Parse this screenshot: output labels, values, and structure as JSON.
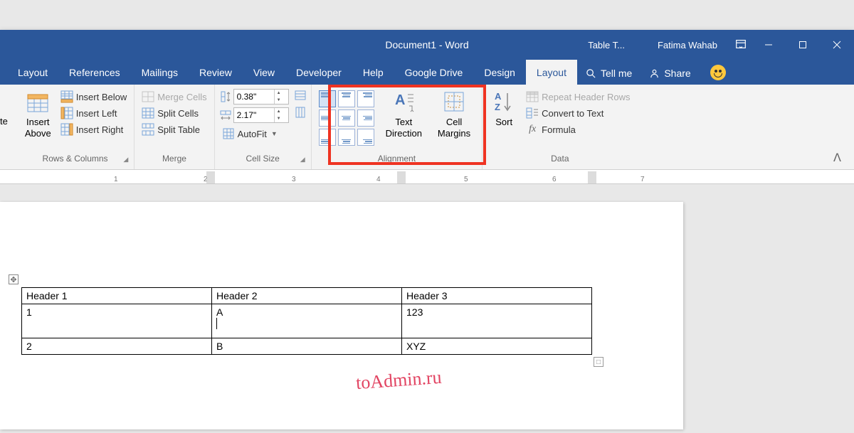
{
  "title": "Document1  -  Word",
  "context_tab_prefix": "Table T...",
  "user": "Fatima Wahab",
  "tabs": {
    "layout_page": "Layout",
    "references": "References",
    "mailings": "Mailings",
    "review": "Review",
    "view": "View",
    "developer": "Developer",
    "help": "Help",
    "google_drive": "Google Drive",
    "design": "Design",
    "layout_table": "Layout",
    "tell_me": "Tell me",
    "share": "Share"
  },
  "ribbon": {
    "rows_cols": {
      "delete_partial": "te",
      "insert_above": "Insert\nAbove",
      "insert_below": "Insert Below",
      "insert_left": "Insert Left",
      "insert_right": "Insert Right",
      "group": "Rows & Columns"
    },
    "merge": {
      "merge_cells": "Merge Cells",
      "split_cells": "Split Cells",
      "split_table": "Split Table",
      "group": "Merge"
    },
    "cell_size": {
      "height": "0.38\"",
      "width": "2.17\"",
      "autofit": "AutoFit",
      "group": "Cell Size"
    },
    "alignment": {
      "text_direction": "Text\nDirection",
      "cell_margins": "Cell\nMargins",
      "group": "Alignment"
    },
    "data": {
      "sort": "Sort",
      "repeat_header": "Repeat Header Rows",
      "convert_text": "Convert to Text",
      "formula": "Formula",
      "group": "Data"
    }
  },
  "ruler_numbers": [
    "1",
    "2",
    "3",
    "4",
    "5",
    "6",
    "7"
  ],
  "table": {
    "headers": [
      "Header 1",
      "Header 2",
      "Header 3"
    ],
    "rows": [
      [
        "1",
        "A",
        "123"
      ],
      [
        "2",
        "B",
        "XYZ"
      ]
    ]
  },
  "watermark": "toAdmin.ru"
}
